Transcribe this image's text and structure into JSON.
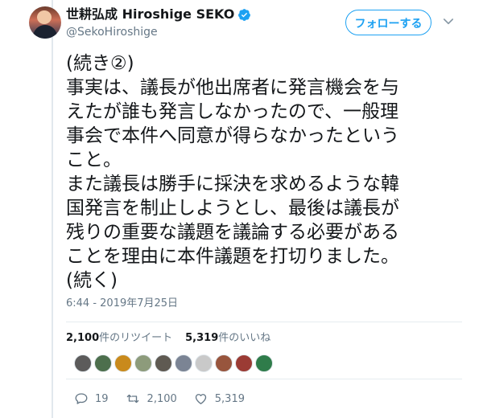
{
  "header": {
    "display_name": "世耕弘成 Hiroshige SEKO",
    "handle": "@SekoHiroshige",
    "follow_label": "フォローする"
  },
  "tweet": {
    "lines": [
      "(続き②)",
      "事実は、議長が他出席者に発言機会を与",
      "えたが誰も発言しなかったので、一般理",
      "事会で本件へ同意が得らなかったという",
      "こと。",
      "また議長は勝手に採決を求めるような韓",
      "国発言を制止しようとし、最後は議長が",
      "残りの重要な議題を議論する必要がある",
      "ことを理由に本件議題を打切りました。",
      "(続く)"
    ],
    "timestamp": "6:44 - 2019年7月25日"
  },
  "stats": {
    "retweet_count": "2,100",
    "retweet_label": "件のリツイート",
    "like_count": "5,319",
    "like_label": "件のいいね"
  },
  "actions": {
    "reply_count": "19",
    "retweet_count": "2,100",
    "like_count": "5,319"
  },
  "liker_avatars": [
    {
      "icon": "liker-avatar-1",
      "color": "#5c5b5b"
    },
    {
      "icon": "liker-avatar-2",
      "color": "#4d6f4d"
    },
    {
      "icon": "liker-avatar-3",
      "color": "#c98a1c"
    },
    {
      "icon": "liker-avatar-4",
      "color": "#8d9b7b"
    },
    {
      "icon": "liker-avatar-5",
      "color": "#5f5a52"
    },
    {
      "icon": "liker-avatar-6",
      "color": "#7b8494"
    },
    {
      "icon": "liker-avatar-7",
      "color": "#c9c9c9"
    },
    {
      "icon": "liker-avatar-8",
      "color": "#98553d"
    },
    {
      "icon": "liker-avatar-9",
      "color": "#9b3b34"
    },
    {
      "icon": "liker-avatar-10",
      "color": "#2f7c4a"
    }
  ],
  "colors": {
    "accent": "#1da1f2",
    "muted": "#657786",
    "text": "#14171a"
  }
}
